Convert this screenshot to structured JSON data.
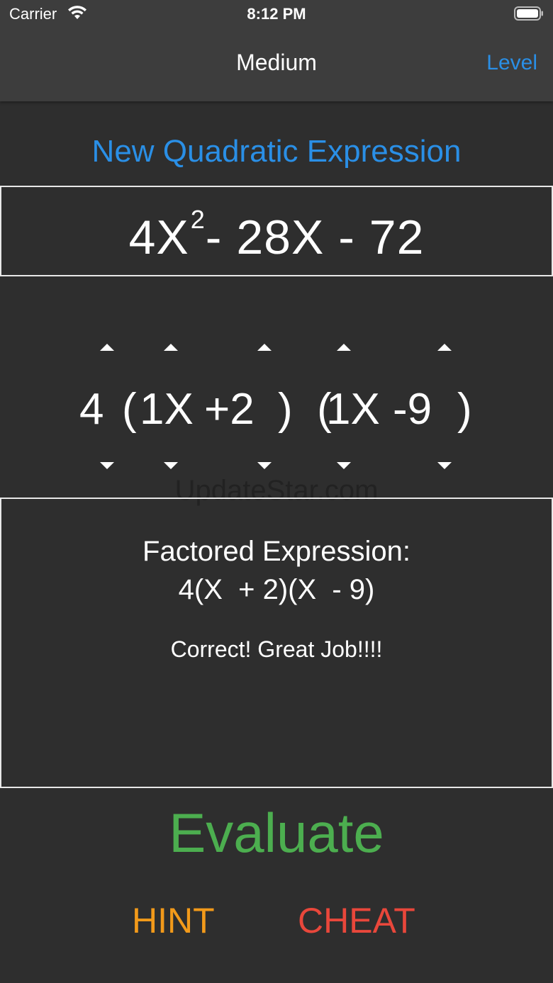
{
  "status_bar": {
    "carrier": "Carrier",
    "time": "8:12 PM",
    "icons": [
      "wifi-icon",
      "battery-icon"
    ]
  },
  "nav": {
    "title": "Medium",
    "level_button": "Level"
  },
  "new_expression_button": "New Quadratic Expression",
  "expression": {
    "coef": "4X",
    "exponent": "2",
    "rest": "- 28X - 72"
  },
  "factor_picker": {
    "gcf": "4",
    "open1": "(",
    "a1": "1X",
    "b1": "+2",
    "close_open": ")  (",
    "a2": "1X",
    "b2": "-9",
    "close2": ")"
  },
  "result": {
    "label": "Factored Expression:",
    "value": "4(X  + 2)(X  - 9)",
    "feedback": "Correct!  Great Job!!!!"
  },
  "watermark": "UpdateStar.com",
  "buttons": {
    "evaluate": "Evaluate",
    "hint": "HINT",
    "cheat": "CHEAT"
  },
  "colors": {
    "accent_blue": "#2a8fe6",
    "evaluate_green": "#4cae4f",
    "hint_orange": "#f29a1a",
    "cheat_red": "#e9473b",
    "background": "#2e2e2e"
  }
}
